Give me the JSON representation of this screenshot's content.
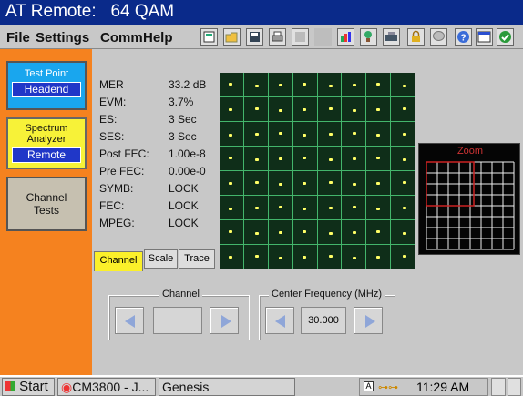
{
  "window": {
    "title": "AT Remote:   64 QAM"
  },
  "menu": {
    "file": "File",
    "settings": "Settings",
    "comm": "Comm",
    "help": "Help"
  },
  "toolbar": {
    "icons": [
      "calculator-icon",
      "open-folder-icon",
      "save-icon",
      "print-icon",
      "blank-icon",
      "blank-icon",
      "chart-icon",
      "tree-icon",
      "device-icon",
      "lock-icon",
      "comment-icon",
      "help-icon",
      "window-icon",
      "check-icon"
    ]
  },
  "sidebar": {
    "test_point": {
      "label": "Test Point",
      "value": "Headend"
    },
    "spectrum": {
      "label": "Spectrum Analyzer",
      "value": "Remote"
    },
    "channel_tests": {
      "label": "Channel Tests"
    }
  },
  "measurements": [
    {
      "label": "MER",
      "value": "33.2 dB"
    },
    {
      "label": "EVM:",
      "value": "3.7%"
    },
    {
      "label": "ES:",
      "value": "3 Sec"
    },
    {
      "label": "SES:",
      "value": "3 Sec"
    },
    {
      "label": "Post FEC:",
      "value": "1.00e-8"
    },
    {
      "label": "Pre FEC:",
      "value": "0.00e-0"
    },
    {
      "label": "SYMB:",
      "value": "LOCK"
    },
    {
      "label": "FEC:",
      "value": "LOCK"
    },
    {
      "label": "MPEG:",
      "value": "LOCK"
    }
  ],
  "tabs": {
    "channel": "Channel",
    "scale": "Scale",
    "trace": "Trace"
  },
  "constellation": {
    "rows": 8,
    "cols": 8
  },
  "zoom": {
    "label": "Zoom"
  },
  "controls": {
    "channel": {
      "legend": "Channel",
      "value": ""
    },
    "center_freq": {
      "legend": "Center Frequency (MHz)",
      "value": "30.000"
    }
  },
  "taskbar": {
    "start": "Start",
    "task1": "CM3800 - J...",
    "task2": "Genesis",
    "clock": "11:29 AM"
  }
}
